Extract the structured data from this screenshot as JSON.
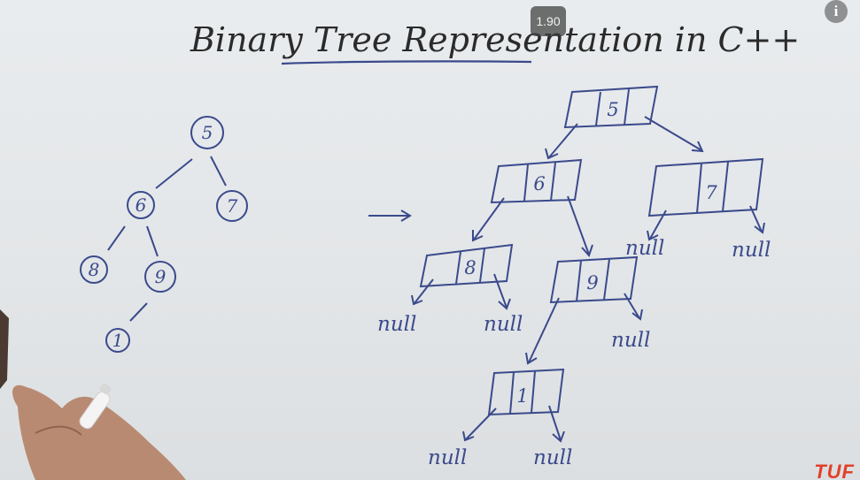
{
  "title": "Binary Tree Representation in C++",
  "colors": {
    "ink_black": "#2a2a2a",
    "ink_blue": "#3a4a8c",
    "board": "#e6e9eb",
    "watermark": "#e2402a"
  },
  "tree": {
    "root": "5",
    "level1": [
      "6",
      "7"
    ],
    "level2": [
      "8",
      "9"
    ],
    "level3": [
      "1"
    ]
  },
  "arrow": "→",
  "memory": {
    "node_5": "5",
    "node_6": "6",
    "node_7": "7",
    "node_8": "8",
    "node_9": "9",
    "node_1": "1",
    "null_label": "null"
  },
  "player": {
    "speed": "1.90",
    "info_icon": "info-icon"
  },
  "watermark": "TUF"
}
